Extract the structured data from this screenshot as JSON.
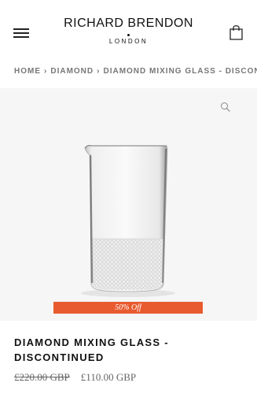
{
  "header": {
    "brand_name": "RICHARD BRENDON",
    "brand_sub": "LONDON",
    "menu_icon": "hamburger-menu-icon",
    "cart_icon": "shopping-bag-icon"
  },
  "breadcrumb": {
    "items": [
      "HOME",
      "DIAMOND",
      "DIAMOND MIXING GLASS - DISCONTINUED"
    ]
  },
  "gallery": {
    "zoom_icon": "magnifier-icon",
    "badge": "50% Off"
  },
  "product": {
    "title": "DIAMOND MIXING GLASS - DISCONTINUED",
    "old_price": "£220.00 GBP",
    "new_price": "£110.00 GBP"
  },
  "colors": {
    "accent": "#e85a2f",
    "text": "#1a1a1a",
    "muted": "#777777",
    "gallery_bg": "#f6f6f6"
  }
}
